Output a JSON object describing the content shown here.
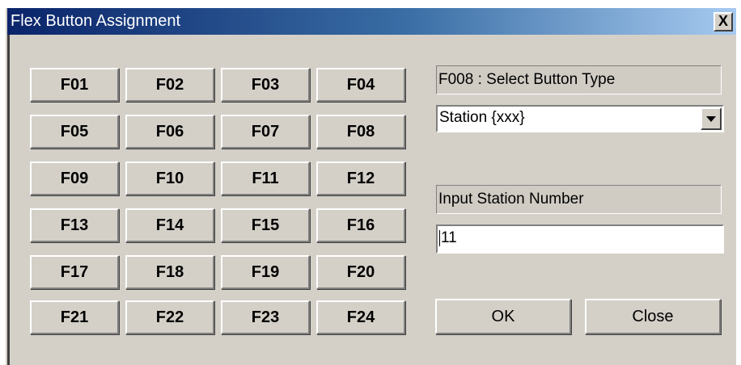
{
  "window": {
    "title": "Flex Button Assignment",
    "close_glyph": "X"
  },
  "flex_buttons": [
    "F01",
    "F02",
    "F03",
    "F04",
    "F05",
    "F06",
    "F07",
    "F08",
    "F09",
    "F10",
    "F11",
    "F12",
    "F13",
    "F14",
    "F15",
    "F16",
    "F17",
    "F18",
    "F19",
    "F20",
    "F21",
    "F22",
    "F23",
    "F24"
  ],
  "panel": {
    "type_label": "F008 : Select Button Type",
    "type_value": "Station {xxx}",
    "station_label": "Input Station Number",
    "station_value": "11"
  },
  "actions": {
    "ok": "OK",
    "close": "Close"
  }
}
